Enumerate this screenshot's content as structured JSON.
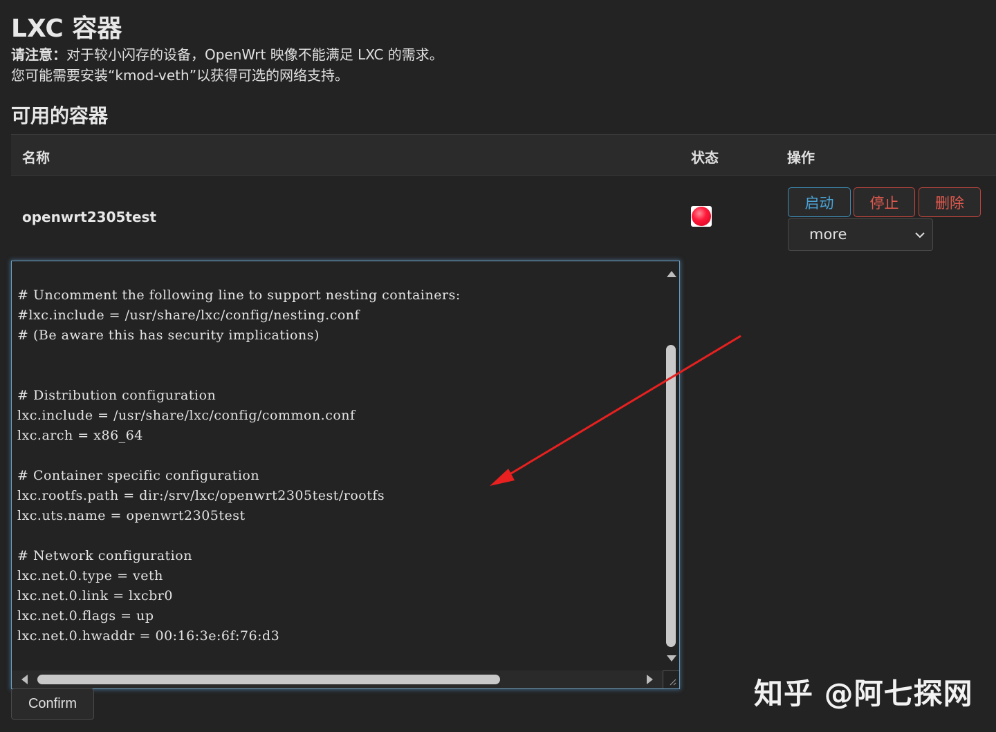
{
  "header": {
    "title": "LXC 容器",
    "notice_label": "请注意：",
    "notice_line1": "对于较小闪存的设备，OpenWrt 映像不能满足 LXC 的需求。",
    "notice_line2": "您可能需要安装“kmod-veth”以获得可选的网络支持。"
  },
  "section": {
    "title": "可用的容器"
  },
  "table": {
    "columns": [
      "名称",
      "状态",
      "操作"
    ],
    "rows": [
      {
        "name": "openwrt2305test",
        "status_color": "#ff1a3a",
        "actions": {
          "start_label": "启动",
          "stop_label": "停止",
          "delete_label": "删除",
          "more_select": "more"
        }
      }
    ]
  },
  "editor": {
    "lines": [
      "# Uncomment the following line to support nesting containers:",
      "#lxc.include = /usr/share/lxc/config/nesting.conf",
      "# (Be aware this has security implications)",
      "",
      "",
      "# Distribution configuration",
      "lxc.include = /usr/share/lxc/config/common.conf",
      "lxc.arch = x86_64",
      "",
      "# Container specific configuration",
      "lxc.rootfs.path = dir:/srv/lxc/openwrt2305test/rootfs",
      "lxc.uts.name = openwrt2305test",
      "",
      "# Network configuration",
      "lxc.net.0.type = veth",
      "lxc.net.0.link = lxcbr0",
      "lxc.net.0.flags = up",
      "lxc.net.0.hwaddr = 00:16:3e:6f:76:d3"
    ]
  },
  "confirm_label": "Confirm",
  "watermark": "知乎 @阿七探网",
  "colors": {
    "accent_blue": "#4aa3d6",
    "danger_red": "#e05a4f",
    "annotation_arrow": "#e8201f"
  }
}
